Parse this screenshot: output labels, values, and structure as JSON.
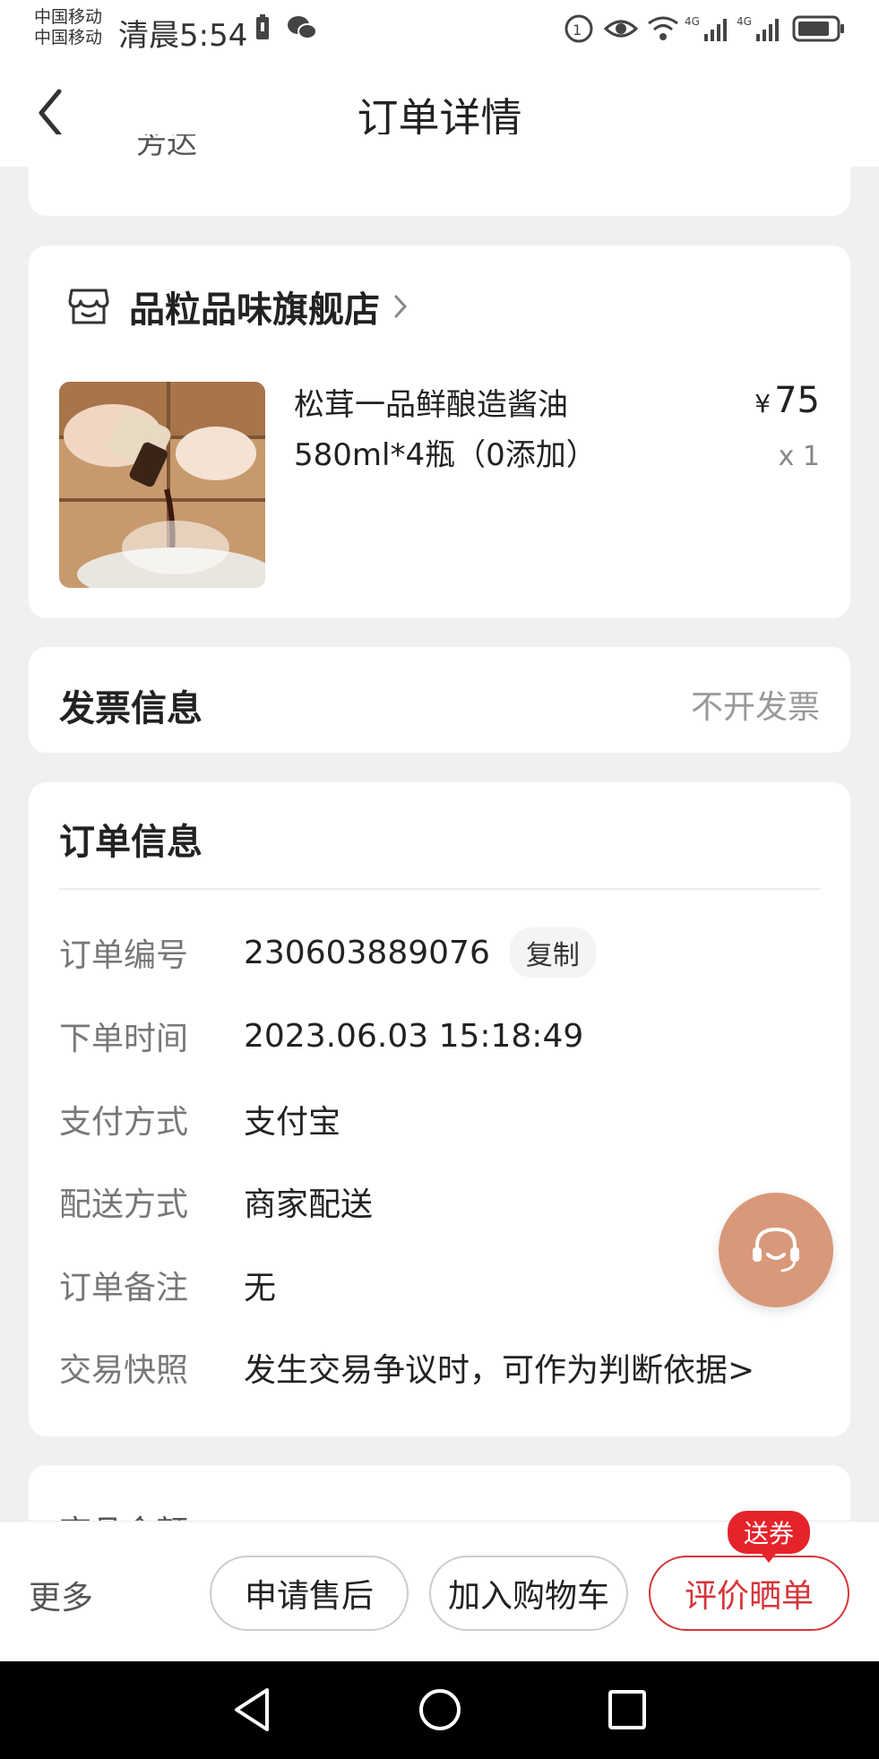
{
  "status_bar": {
    "carrier_1": "中国移动",
    "carrier_2": "中国移动",
    "time": "清晨5:54"
  },
  "header": {
    "title": "订单详情"
  },
  "partial_address": {
    "text": "芳达"
  },
  "store": {
    "name": "品粒品味旗舰店"
  },
  "product": {
    "name": "松茸一品鲜酿造酱油580ml*4瓶（0添加）",
    "currency": "¥",
    "price": "75",
    "qty": "x 1"
  },
  "invoice": {
    "label": "发票信息",
    "value": "不开发票"
  },
  "order_info": {
    "title": "订单信息",
    "copy_label": "复制",
    "rows": [
      {
        "key": "订单编号",
        "value": "230603889076"
      },
      {
        "key": "下单时间",
        "value": "2023.06.03 15:18:49"
      },
      {
        "key": "支付方式",
        "value": "支付宝"
      },
      {
        "key": "配送方式",
        "value": "商家配送"
      },
      {
        "key": "订单备注",
        "value": "无"
      },
      {
        "key": "交易快照",
        "value": "发生交易争议时，可作为判断依据>"
      }
    ]
  },
  "partial_amount": {
    "label": "商品金额"
  },
  "bottom_bar": {
    "more": "更多",
    "after_sales": "申请售后",
    "add_cart": "加入购物车",
    "review": "评价晒单",
    "badge": "送券"
  },
  "colors": {
    "accent_red": "#d5363a",
    "badge_red": "#e5232b",
    "service_orange": "#d9987a"
  }
}
